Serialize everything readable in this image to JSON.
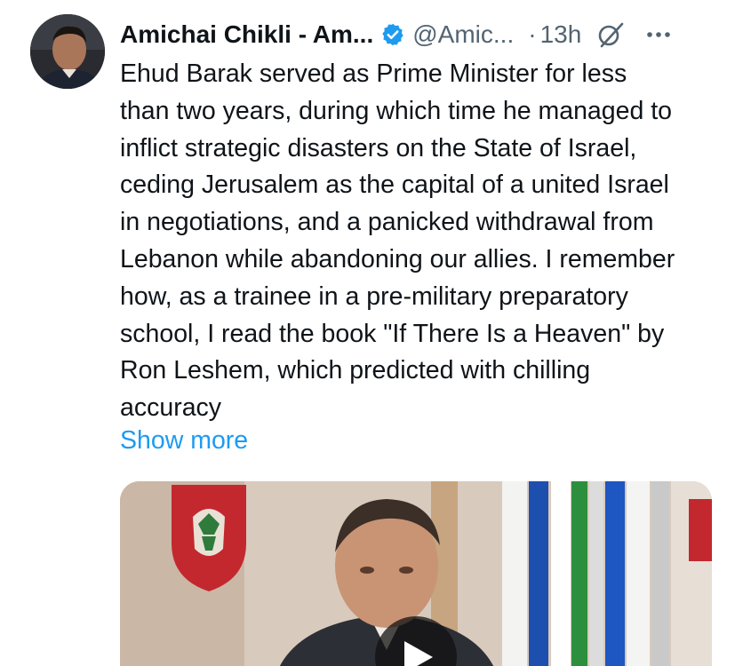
{
  "tweet": {
    "author": {
      "display_name": "Amichai Chikli - Am...",
      "handle": "@Amic...",
      "verified": true,
      "avatar_icon": "profile-photo"
    },
    "separator": "·",
    "timestamp": "13h",
    "body_lines": [
      "Ehud Barak served as Prime Minister for less",
      "than two years, during which time he managed to",
      "inflict strategic disasters on the State of Israel,",
      "ceding Jerusalem as the capital of a united Israel",
      "in negotiations, and a panicked withdrawal from",
      "Lebanon while abandoning our allies. I remember",
      "how, as a trainee in a pre-military preparatory",
      "school, I read the book \"If There Is a Heaven\" by",
      "Ron Leshem, which predicted with chilling",
      "accuracy"
    ],
    "show_more_label": "Show more",
    "media": {
      "type": "video",
      "play_icon": "play-icon"
    }
  },
  "colors": {
    "text": "#0f1419",
    "secondary": "#536471",
    "link": "#1d9bf0",
    "verified": "#1d9bf0"
  }
}
